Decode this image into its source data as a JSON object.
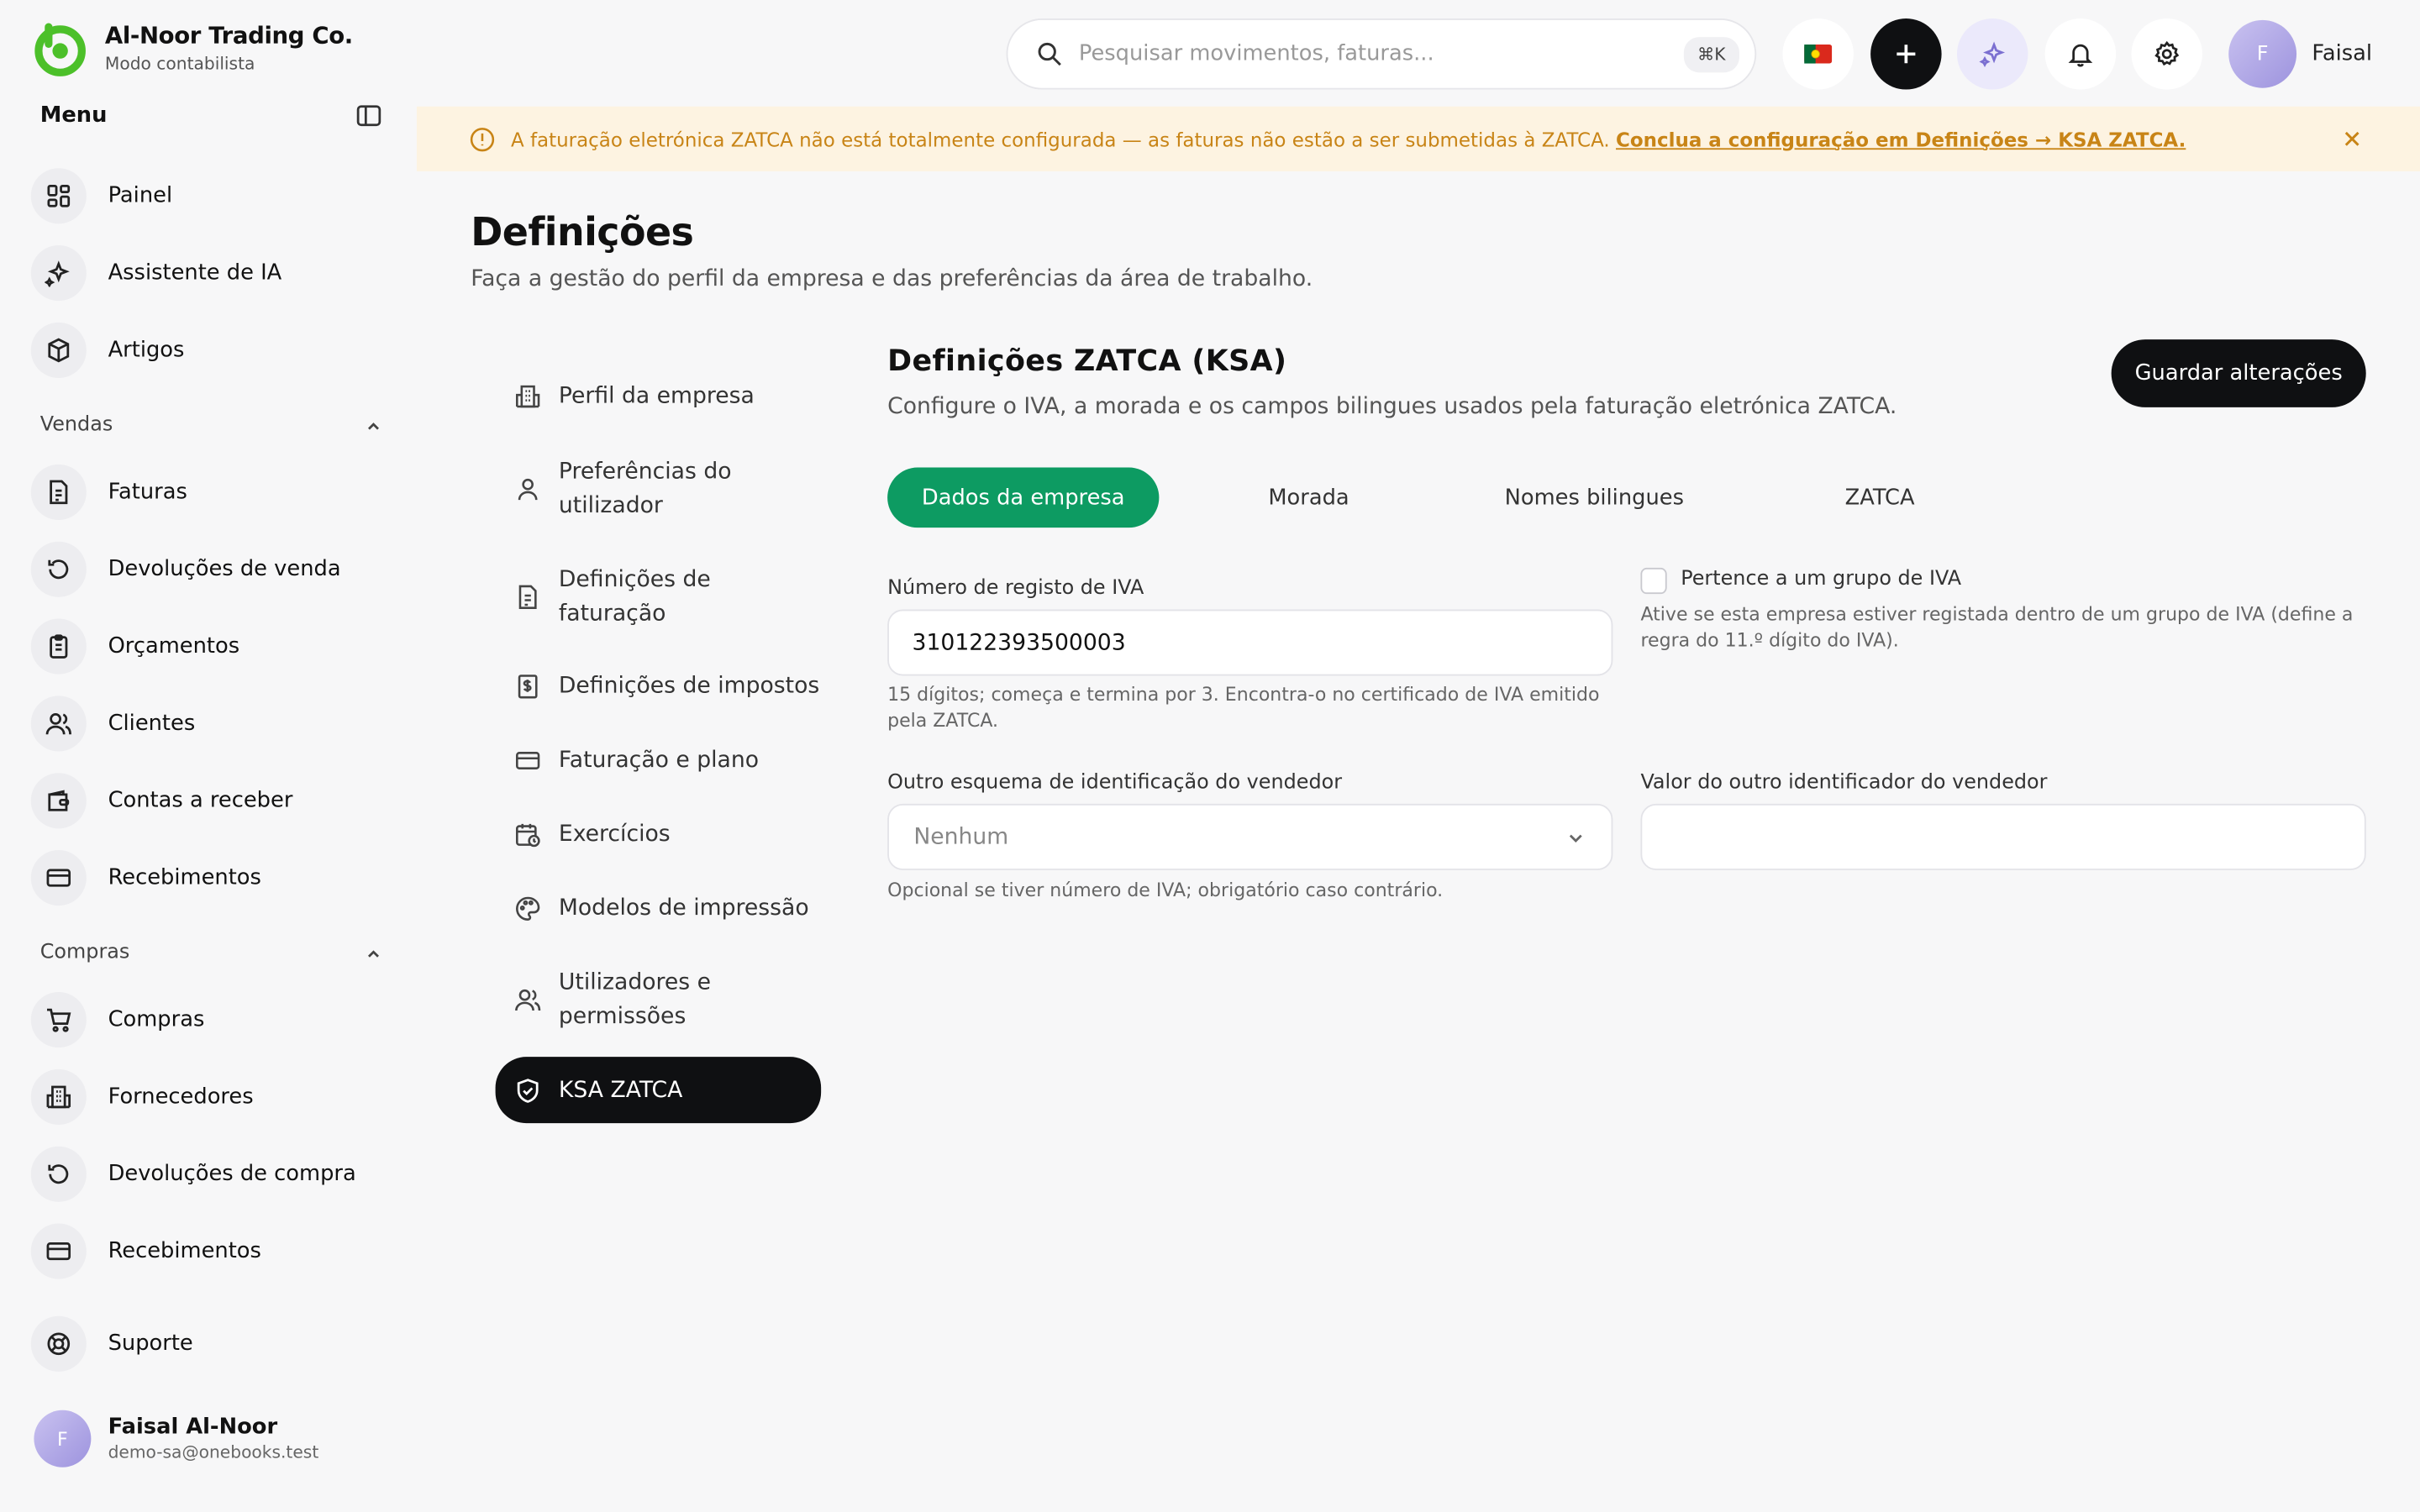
{
  "brand": {
    "name": "Al-Noor Trading Co.",
    "mode": "Modo contabilista",
    "accent": "#4cc02a"
  },
  "sidebar": {
    "menu_title": "Menu",
    "top_items": [
      {
        "label": "Painel",
        "icon": "dashboard-icon"
      },
      {
        "label": "Assistente de IA",
        "icon": "sparkle-icon"
      },
      {
        "label": "Artigos",
        "icon": "box-icon"
      }
    ],
    "sales": {
      "title": "Vendas",
      "items": [
        {
          "label": "Faturas",
          "icon": "invoice-icon"
        },
        {
          "label": "Devoluções de venda",
          "icon": "return-icon"
        },
        {
          "label": "Orçamentos",
          "icon": "clipboard-icon"
        },
        {
          "label": "Clientes",
          "icon": "users-icon"
        },
        {
          "label": "Contas a receber",
          "icon": "wallet-icon"
        },
        {
          "label": "Recebimentos",
          "icon": "card-icon"
        }
      ]
    },
    "purchases": {
      "title": "Compras",
      "items": [
        {
          "label": "Compras",
          "icon": "cart-icon"
        },
        {
          "label": "Fornecedores",
          "icon": "building-icon"
        },
        {
          "label": "Devoluções de compra",
          "icon": "return-icon"
        },
        {
          "label": "Recebimentos",
          "icon": "card-icon"
        }
      ]
    },
    "support": {
      "label": "Suporte",
      "icon": "lifebuoy-icon"
    },
    "user": {
      "initial": "F",
      "name": "Faisal Al-Noor",
      "email": "demo-sa@onebooks.test"
    }
  },
  "topbar": {
    "search_placeholder": "Pesquisar movimentos, faturas...",
    "shortcut": "⌘K",
    "user_initial": "F",
    "user_name": "Faisal"
  },
  "banner": {
    "text": "A faturação eletrónica ZATCA não está totalmente configurada — as faturas não estão a ser submetidas à ZATCA.",
    "link": "Conclua a configuração em Definições → KSA ZATCA.",
    "color": "#c88416"
  },
  "page": {
    "title": "Definições",
    "subtitle": "Faça a gestão do perfil da empresa e das preferências da área de trabalho."
  },
  "settings_nav": [
    {
      "label": "Perfil da empresa",
      "icon": "building-icon"
    },
    {
      "label": "Preferências do utilizador",
      "icon": "user-icon"
    },
    {
      "label": "Definições de faturação",
      "icon": "document-icon"
    },
    {
      "label": "Definições de impostos",
      "icon": "tax-icon"
    },
    {
      "label": "Faturação e plano",
      "icon": "card-icon"
    },
    {
      "label": "Exercícios",
      "icon": "calendar-icon"
    },
    {
      "label": "Modelos de impressão",
      "icon": "palette-icon"
    },
    {
      "label": "Utilizadores e permissões",
      "icon": "users-icon"
    },
    {
      "label": "KSA ZATCA",
      "icon": "shield-icon",
      "active": true
    }
  ],
  "content": {
    "title": "Definições ZATCA (KSA)",
    "subtitle": "Configure o IVA, a morada e os campos bilingues usados pela faturação eletrónica ZATCA.",
    "save_label": "Guardar alterações",
    "tabs": [
      "Dados da empresa",
      "Morada",
      "Nomes bilingues",
      "ZATCA"
    ],
    "active_tab": "Dados da empresa",
    "vat": {
      "label": "Número de registo de IVA",
      "value": "310122393500003",
      "help": "15 dígitos; começa e termina por 3. Encontra-o no certificado de IVA emitido pela ZATCA."
    },
    "vat_group": {
      "label": "Pertence a um grupo de IVA",
      "checked": false,
      "help": "Ative se esta empresa estiver registada dentro de um grupo de IVA (define a regra do 11.º dígito do IVA)."
    },
    "other_scheme": {
      "label": "Outro esquema de identificação do vendedor",
      "value": "Nenhum",
      "help": "Opcional se tiver número de IVA; obrigatório caso contrário."
    },
    "other_value": {
      "label": "Valor do outro identificador do vendedor",
      "value": ""
    }
  },
  "colors": {
    "primary_green": "#0d9b62",
    "dark": "#0f1012"
  }
}
